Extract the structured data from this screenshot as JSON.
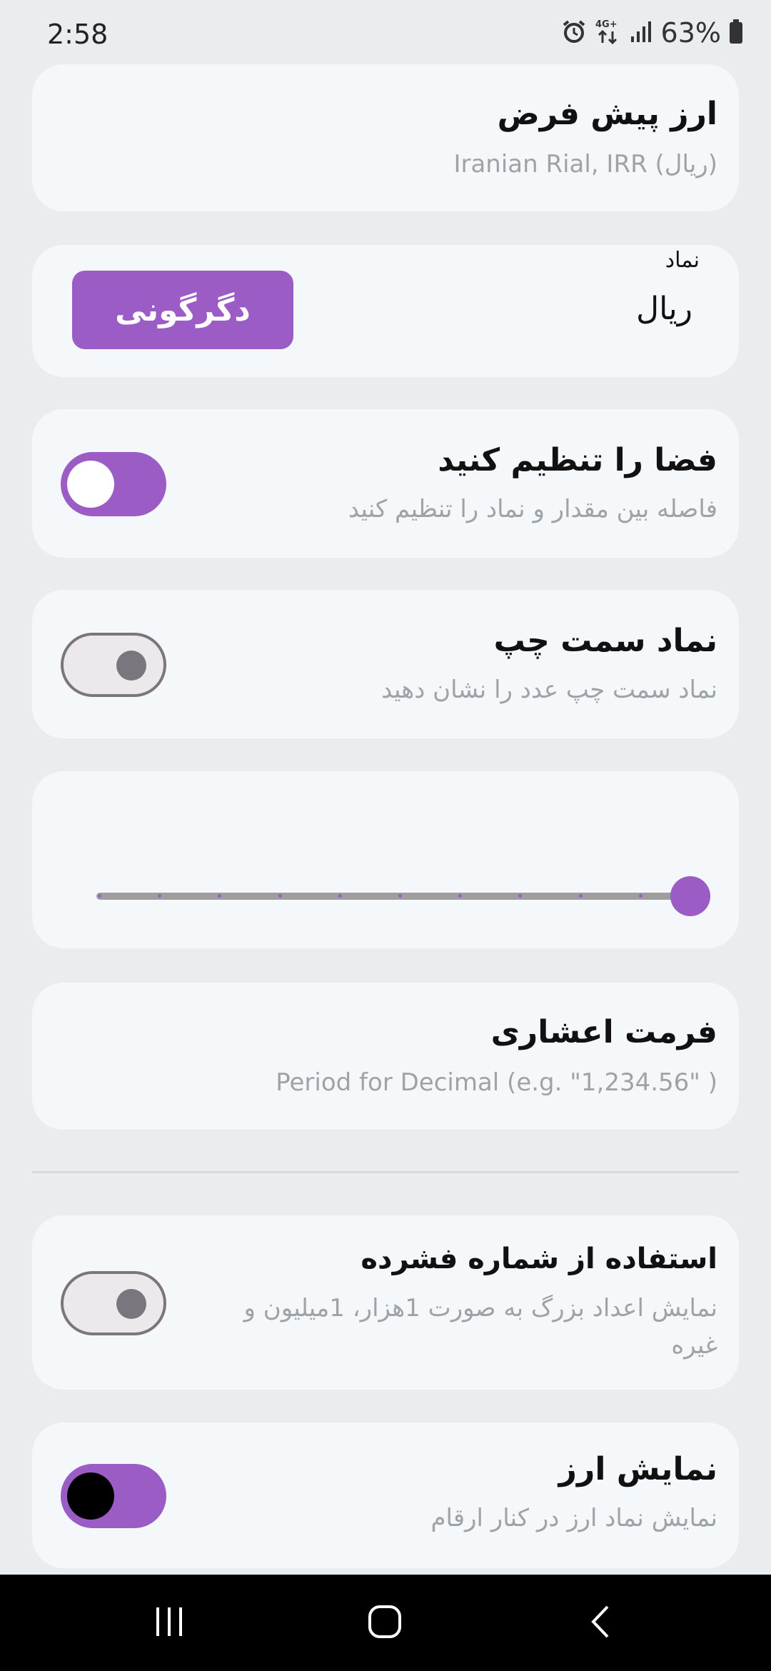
{
  "status_bar": {
    "time": "2:58",
    "network": "4G+",
    "battery_percent": "63%",
    "icons": [
      "alarm-icon",
      "network-4g-icon",
      "signal-icon",
      "battery-icon"
    ]
  },
  "default_currency": {
    "title": "ارز پیش فرض",
    "value": "Iranian Rial, IRR (ریال)"
  },
  "symbol": {
    "label": "نماد",
    "value": "ریال",
    "change_button": "دگرگونی"
  },
  "space_setting": {
    "title": "فضا را تنظیم کنید",
    "subtitle": "فاصله بین مقدار و نماد را تنظیم کنید",
    "enabled": true
  },
  "symbol_left": {
    "title": "نماد سمت چپ",
    "subtitle": "نماد سمت چپ عدد را نشان دهید",
    "enabled": false
  },
  "slider": {
    "value_fraction": 1.0,
    "steps": 11
  },
  "decimal_format": {
    "title": "فرمت اعشاری",
    "subtitle": "Period for Decimal (e.g. \"1,234.56\" )"
  },
  "compact_number": {
    "title": "استفاده از شماره فشرده",
    "subtitle": "نمایش اعداد بزرگ به صورت 1هزار، 1میلیون و غیره",
    "enabled": false
  },
  "show_currency": {
    "title": "نمایش ارز",
    "subtitle": "نمایش نماد ارز در کنار ارقام",
    "enabled": true
  },
  "colors": {
    "accent": "#9b5cc6",
    "card": "#f5f8fa",
    "background": "#e9edf0",
    "subtitle": "#9ea3a8"
  },
  "navigation": {
    "recents": "recents-icon",
    "home": "home-icon",
    "back": "back-icon"
  }
}
